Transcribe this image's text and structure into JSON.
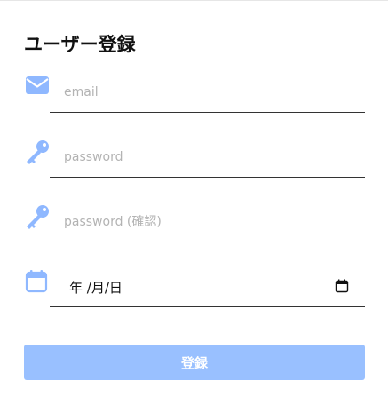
{
  "form": {
    "title": "ユーザー登録",
    "fields": [
      {
        "icon": "envelope-icon",
        "placeholder": "email",
        "type": "email"
      },
      {
        "icon": "key-icon",
        "placeholder": "password",
        "type": "password"
      },
      {
        "icon": "key-icon",
        "placeholder": "password (確認)",
        "type": "password"
      },
      {
        "icon": "calendar-icon",
        "type": "date",
        "display": "年 /月/日"
      }
    ],
    "submit_label": "登録"
  },
  "colors": {
    "icon": "#8fb8ff",
    "button": "#99c0ff",
    "underline": "#333333",
    "placeholder": "#b3b3b3"
  }
}
